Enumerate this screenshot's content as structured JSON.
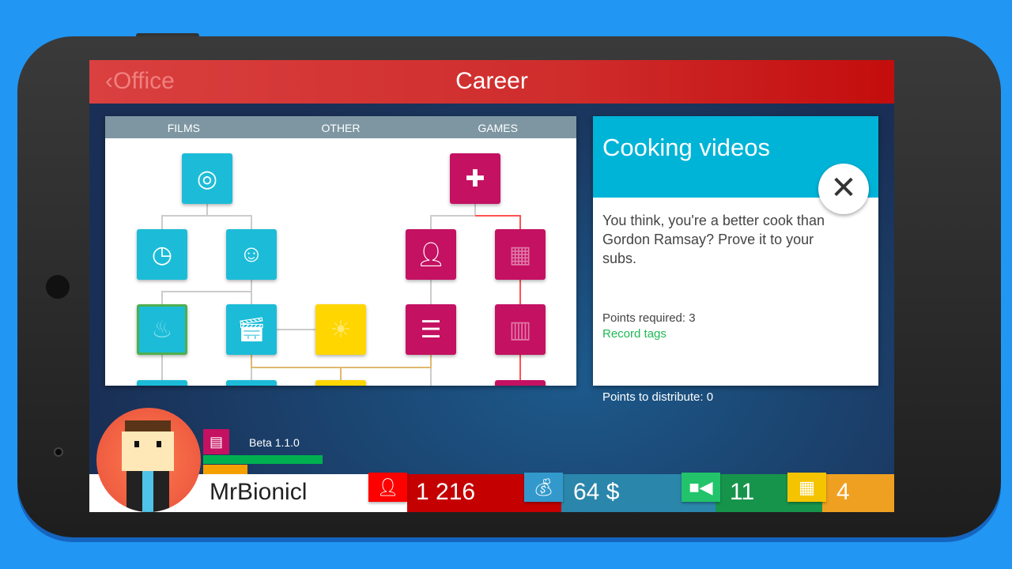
{
  "header": {
    "back_label": "Office",
    "title": "Career"
  },
  "tree": {
    "tabs": [
      "FILMS",
      "OTHER",
      "GAMES"
    ],
    "nodes": [
      {
        "icon": "camera-aperture-icon",
        "color": "cyan"
      },
      {
        "icon": "clock-icon",
        "color": "cyan"
      },
      {
        "icon": "smiley-tag-icon",
        "color": "cyan"
      },
      {
        "icon": "flame-icon",
        "color": "cyan",
        "selected": true
      },
      {
        "icon": "clapperboard-icon",
        "color": "cyan"
      },
      {
        "icon": "sun-icon",
        "color": "yellow"
      },
      {
        "icon": "gamepad-icon",
        "color": "magenta"
      },
      {
        "icon": "person-icon",
        "color": "magenta"
      },
      {
        "icon": "creeper-icon",
        "color": "magenta"
      },
      {
        "icon": "list-icon",
        "color": "magenta"
      },
      {
        "icon": "map-icon",
        "color": "magenta"
      }
    ]
  },
  "detail": {
    "title": "Cooking videos",
    "description": "You think, you're a better cook than Gordon Ramsay? Prove it to your subs.",
    "points_required": "Points required: 3",
    "requirement": "Record tags"
  },
  "points_to_distribute": "Points to distribute: 0",
  "player": {
    "version": "Beta 1.1.0",
    "name": "MrBionicl",
    "xp_progress_green": 0.75,
    "xp_progress_orange": 0.28
  },
  "stats": {
    "subscribers": "1 216",
    "money": "64 $",
    "videos": "11",
    "days": "4"
  },
  "colors": {
    "header": "#cf2c2c",
    "cyan": "#1cbcd8",
    "magenta": "#c51162",
    "yellow": "#ffd600",
    "background": "#2196F3"
  }
}
